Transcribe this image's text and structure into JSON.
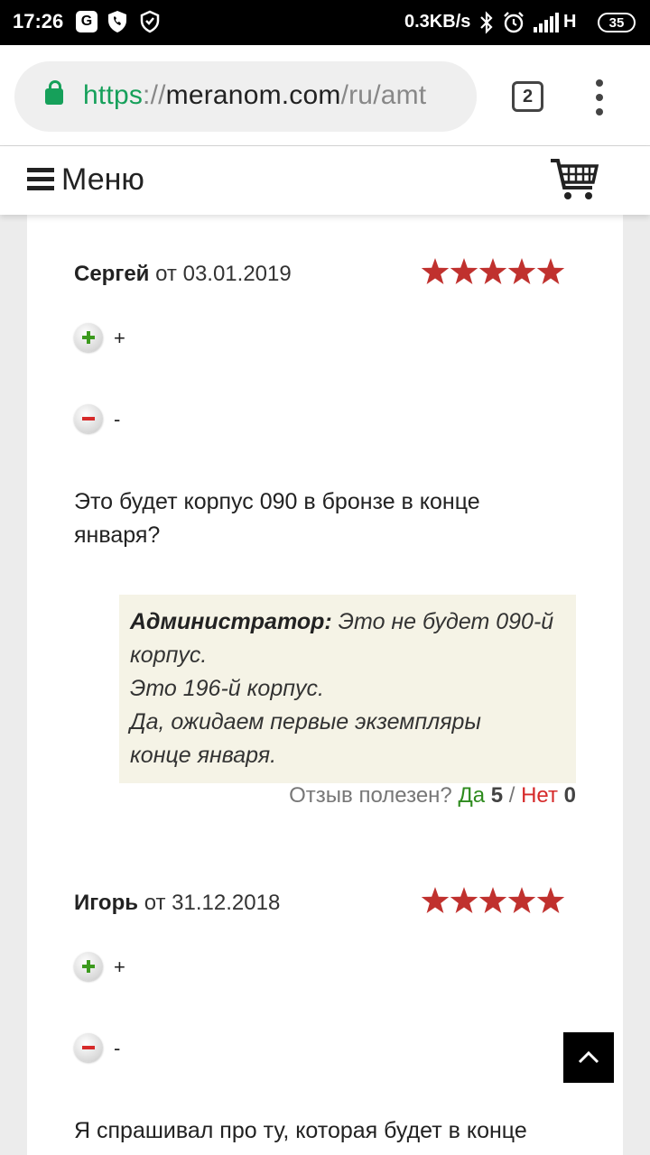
{
  "status_bar": {
    "time": "17:26",
    "icons": [
      "g-icon",
      "phone-shield-icon",
      "shield-check-icon"
    ],
    "net_speed": "0.3KB/s",
    "network_type": "H",
    "battery": "35"
  },
  "browser": {
    "url_scheme": "https",
    "url_separator": "://",
    "url_host": "meranom.com",
    "url_path": "/ru/amt",
    "tab_count": "2",
    "secure_color": "#16a05a"
  },
  "site_header": {
    "menu_label": "Меню",
    "cart_icon": "shopping-cart-icon"
  },
  "reviews": [
    {
      "author": "Сергей",
      "from_prefix": "от",
      "date": "03.01.2019",
      "rating": 5,
      "rating_max": 5,
      "plus_text": "+",
      "minus_text": "-",
      "body": "Это будет корпус 090 в бронзе в конце января?",
      "admin_label": "Администратор:",
      "admin_reply": "Это не будет 090-й корпус. Это 196-й корпус. Да, ожидаем первые экземпляры конце января.",
      "admin_lines": [
        "Это не будет 090-й",
        "корпус.",
        "Это 196-й корпус.",
        "Да, ожидаем первые экземпляры",
        "конце января."
      ],
      "useful_question": "Отзыв полезен?",
      "yes_label": "Да",
      "yes_count": "5",
      "separator": "/",
      "no_label": "Нет",
      "no_count": "0"
    },
    {
      "author": "Игорь",
      "from_prefix": "от",
      "date": "31.12.2018",
      "rating": 5,
      "rating_max": 5,
      "plus_text": "+",
      "minus_text": "-",
      "body": "Я спрашивал про ту, которая будет в конце"
    }
  ],
  "colors": {
    "star": "#c0312e",
    "yes": "#2e8b1e",
    "no": "#d62a2a",
    "admin_bg": "#f5f3e6"
  }
}
